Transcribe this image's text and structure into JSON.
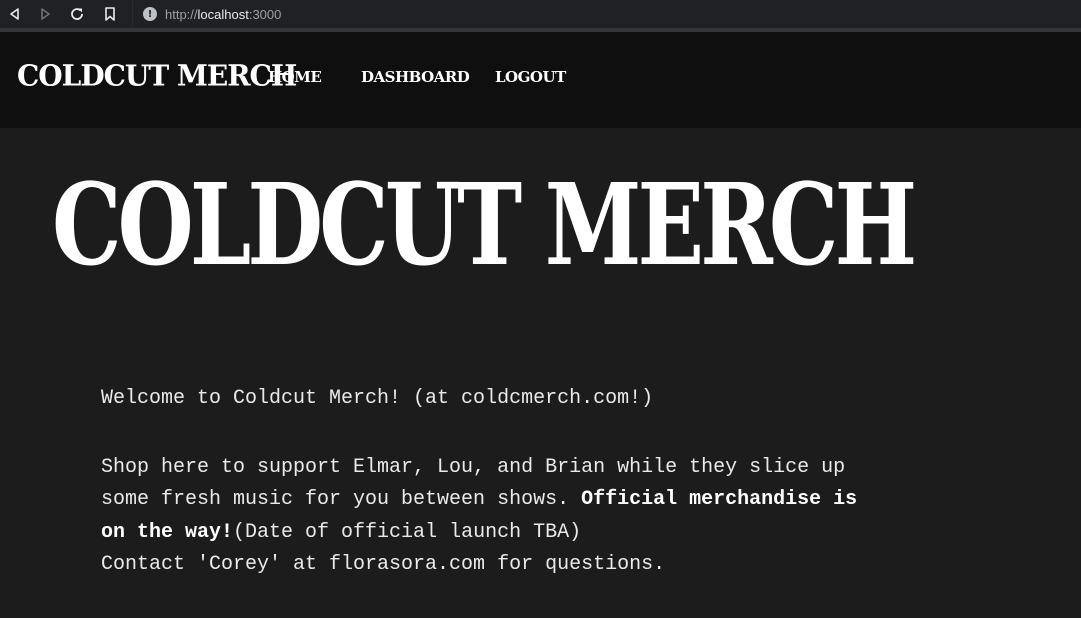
{
  "browser": {
    "url_scheme": "http://",
    "url_host": "localhost",
    "url_port": ":3000",
    "info_icon": "!"
  },
  "header": {
    "brand": "Coldcut Merch",
    "nav": {
      "home": "Home",
      "dashboard": "Dashboard",
      "logout": "Logout"
    }
  },
  "hero": {
    "title": "Coldcut Merch"
  },
  "content": {
    "welcome": "Welcome to Coldcut Merch! (at coldcmerch.com!)",
    "shop_intro": "Shop here to support Elmar, Lou, and Brian while they slice up some fresh music for you between shows. ",
    "official_bold": "Official merchandise is on the way!",
    "launch_note": "(Date of official launch TBA)",
    "contact": "Contact 'Corey' at florasora.com for questions."
  }
}
